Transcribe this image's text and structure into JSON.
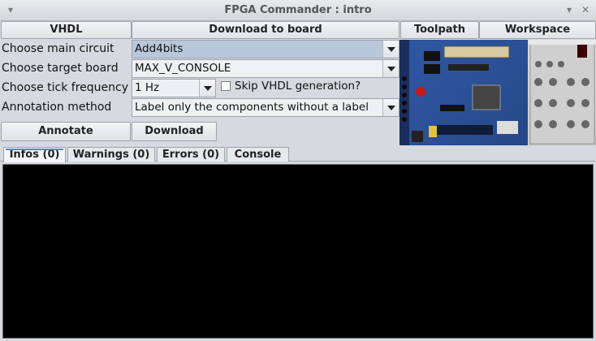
{
  "window": {
    "title": "FPGA Commander : intro"
  },
  "toolbar": {
    "vhdl": "VHDL",
    "download_to_board": "Download to board",
    "toolpath": "Toolpath",
    "workspace": "Workspace"
  },
  "form": {
    "main_circuit_label": "Choose main circuit",
    "main_circuit_value": "Add4bits",
    "target_board_label": "Choose target board",
    "target_board_value": "MAX_V_CONSOLE",
    "tick_frequency_label": "Choose tick frequency",
    "tick_frequency_value": "1 Hz",
    "skip_vhdl_label": "Skip VHDL generation?",
    "skip_vhdl_checked": false,
    "annotation_label": "Annotation method",
    "annotation_value": "Label only the components without a label"
  },
  "actions": {
    "annotate": "Annotate",
    "download": "Download"
  },
  "tabs": [
    {
      "label": "Infos (0)",
      "active": true
    },
    {
      "label": "Warnings (0)",
      "active": false
    },
    {
      "label": "Errors (0)",
      "active": false
    },
    {
      "label": "Console",
      "active": false
    }
  ],
  "colors": {
    "console_bg": "#000000",
    "selected_combo": "#b8c7da",
    "board_blue": "#2f58a3"
  },
  "icons": [
    "minimize-icon",
    "close-icon"
  ]
}
